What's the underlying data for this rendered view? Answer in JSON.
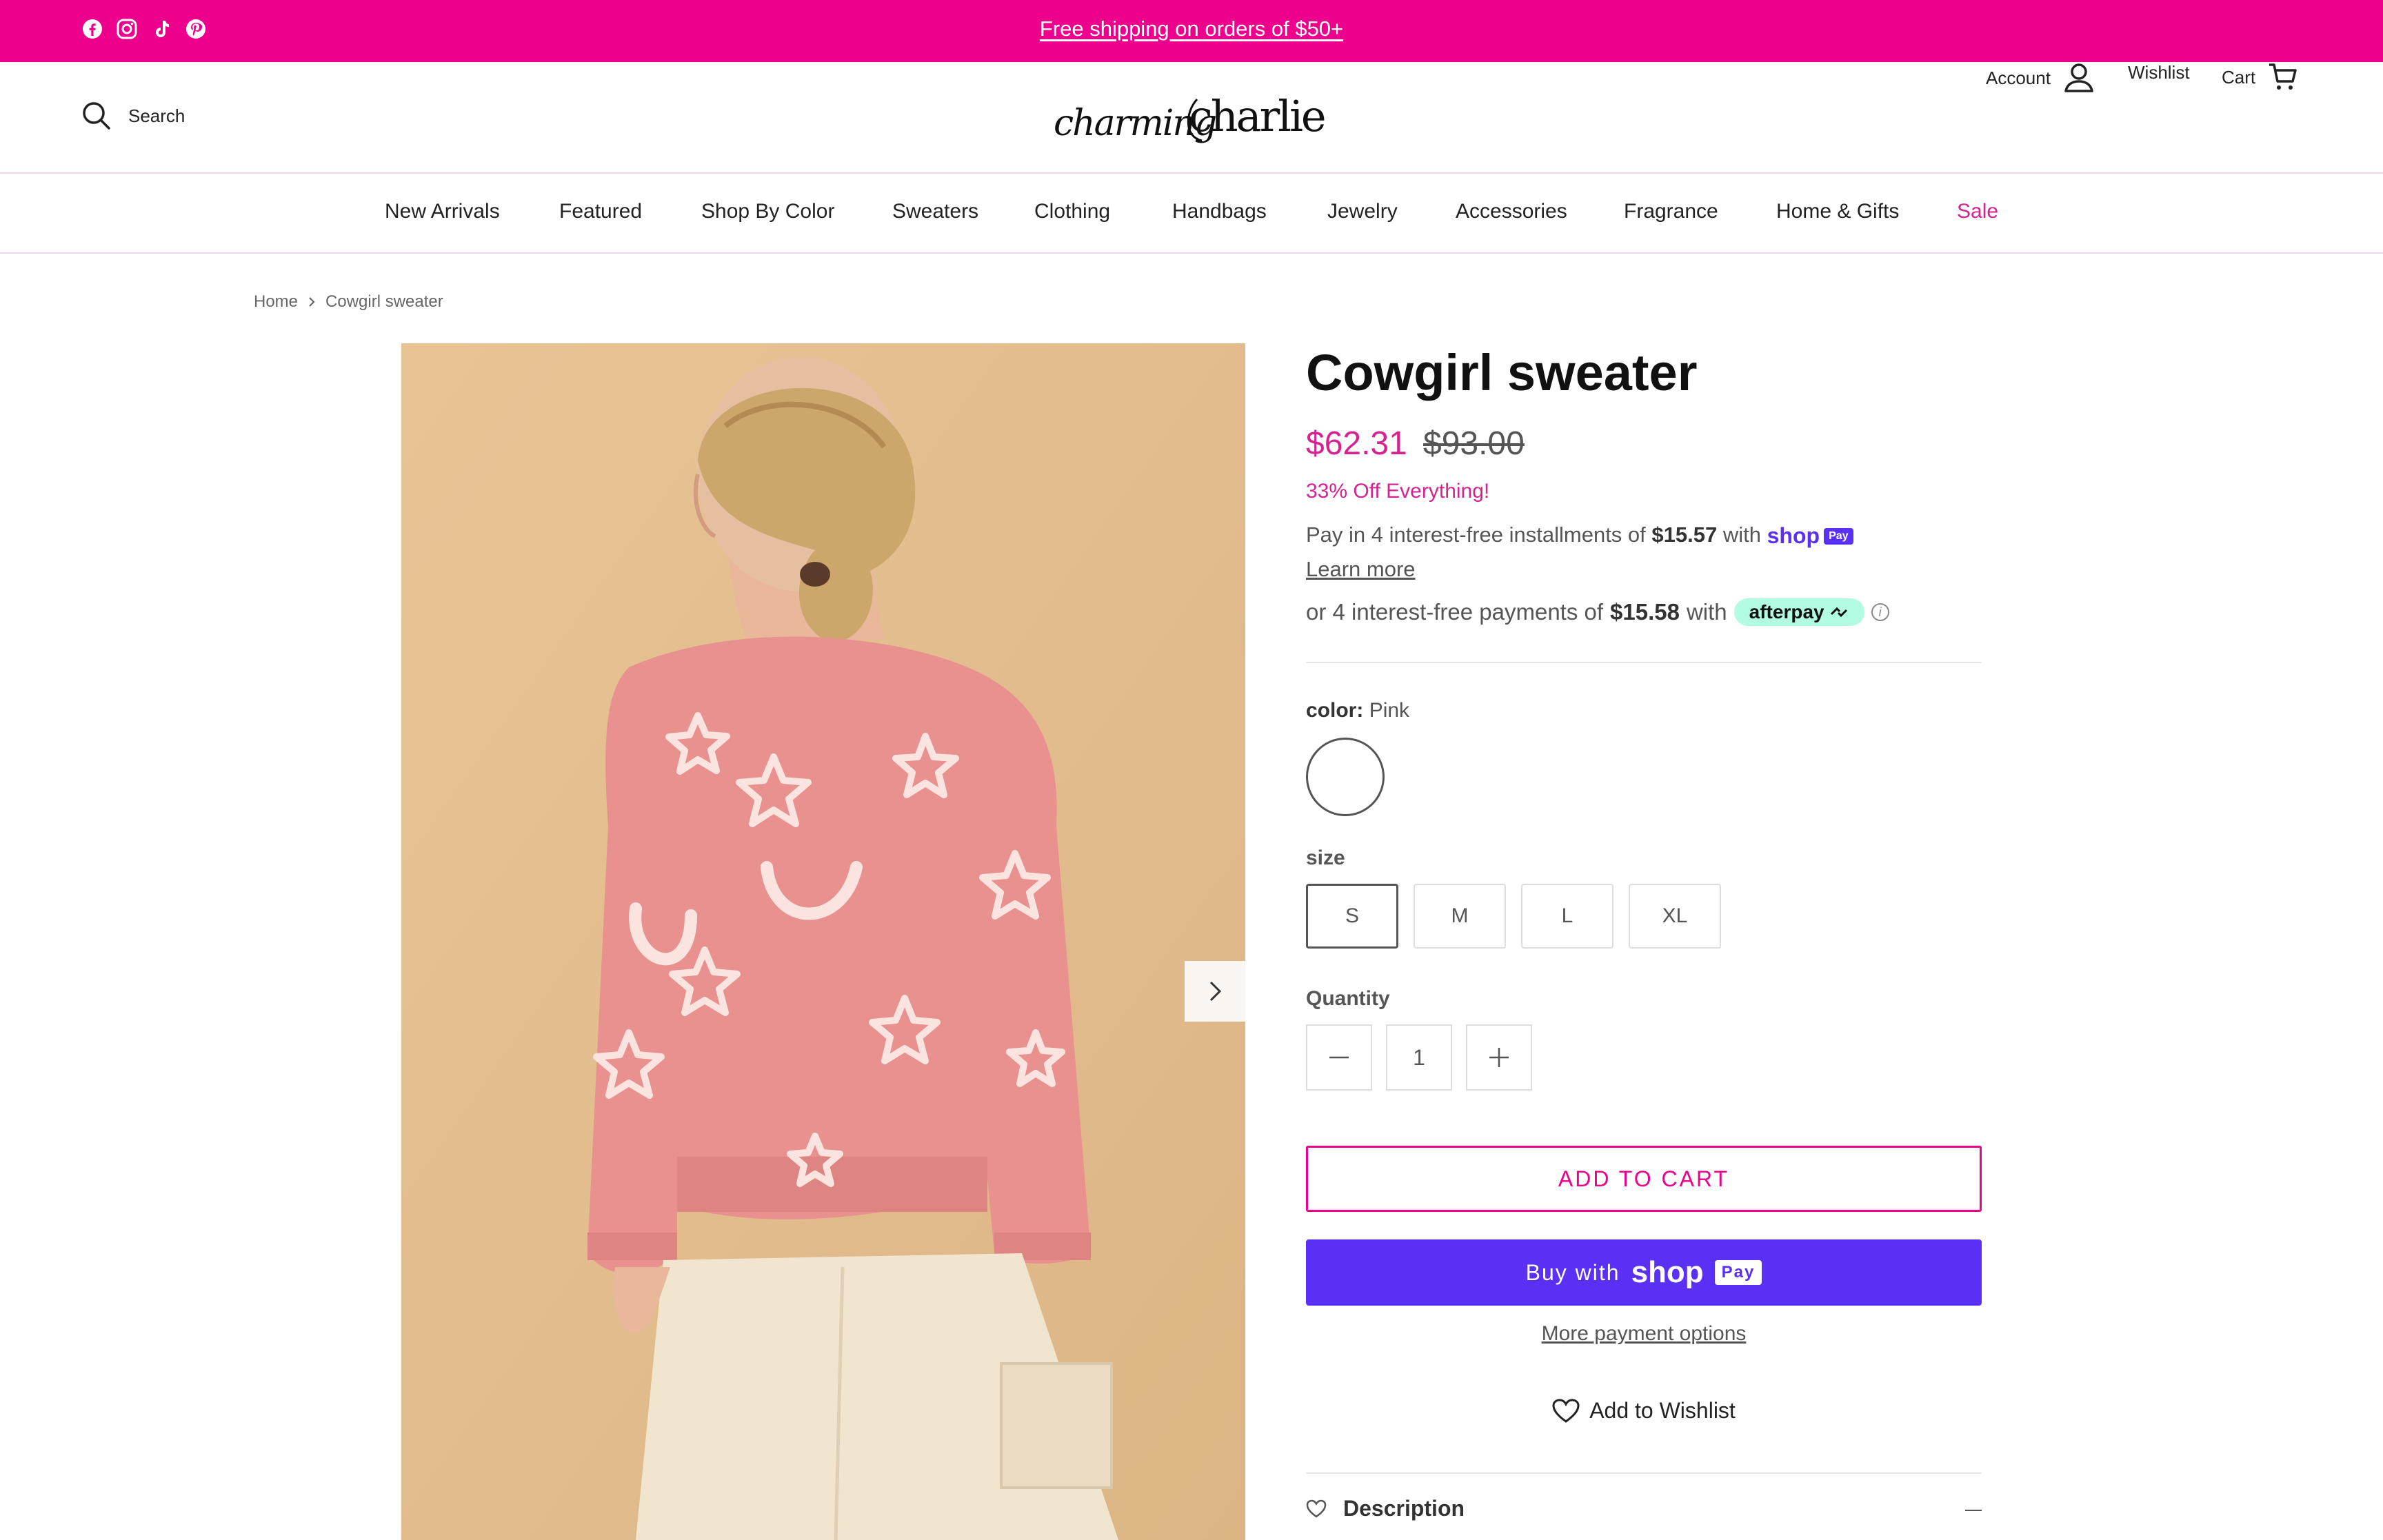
{
  "announcement": {
    "text": "Free shipping on orders of $50+",
    "social_icons": [
      "facebook-icon",
      "instagram-icon",
      "tiktok-icon",
      "pinterest-icon"
    ]
  },
  "header": {
    "search_label": "Search",
    "logo_text": "charming charlie",
    "account_label": "Account",
    "wishlist_label": "Wishlist",
    "cart_label": "Cart"
  },
  "nav": {
    "items": [
      "New Arrivals",
      "Featured",
      "Shop By Color",
      "Sweaters",
      "Clothing",
      "Handbags",
      "Jewelry",
      "Accessories",
      "Fragrance",
      "Home & Gifts",
      "Sale"
    ]
  },
  "breadcrumb": {
    "home": "Home",
    "current": "Cowgirl sweater"
  },
  "product": {
    "title": "Cowgirl sweater",
    "price_sale": "$62.31",
    "price_original": "$93.00",
    "promo": "33% Off Everything!",
    "installments_prefix": "Pay in 4 interest-free installments of",
    "installments_amount": "$15.57",
    "installments_with": "with",
    "shop_pay_brand": "shop",
    "pay_badge": "Pay",
    "learn_more": "Learn more",
    "afterpay_prefix": "or 4 interest-free payments of",
    "afterpay_amount": "$15.58",
    "afterpay_with": "with",
    "afterpay_brand": "afterpay",
    "info_glyph": "i",
    "color_label": "color:",
    "color_value": "Pink",
    "size_label": "size",
    "sizes": [
      "S",
      "M",
      "L",
      "XL"
    ],
    "selected_size": "S",
    "quantity_label": "Quantity",
    "quantity": "1",
    "add_to_cart": "ADD TO CART",
    "buy_with": "Buy with",
    "more_payment": "More payment options",
    "add_to_wishlist": "Add to Wishlist",
    "description_label": "Description"
  },
  "colors": {
    "brand_pink": "#ec008c",
    "sale_pink": "#d6238f",
    "shop_pay_purple": "#5a31f4",
    "afterpay_mint": "#b2fce4",
    "sweater_pink": "#e8918f"
  }
}
